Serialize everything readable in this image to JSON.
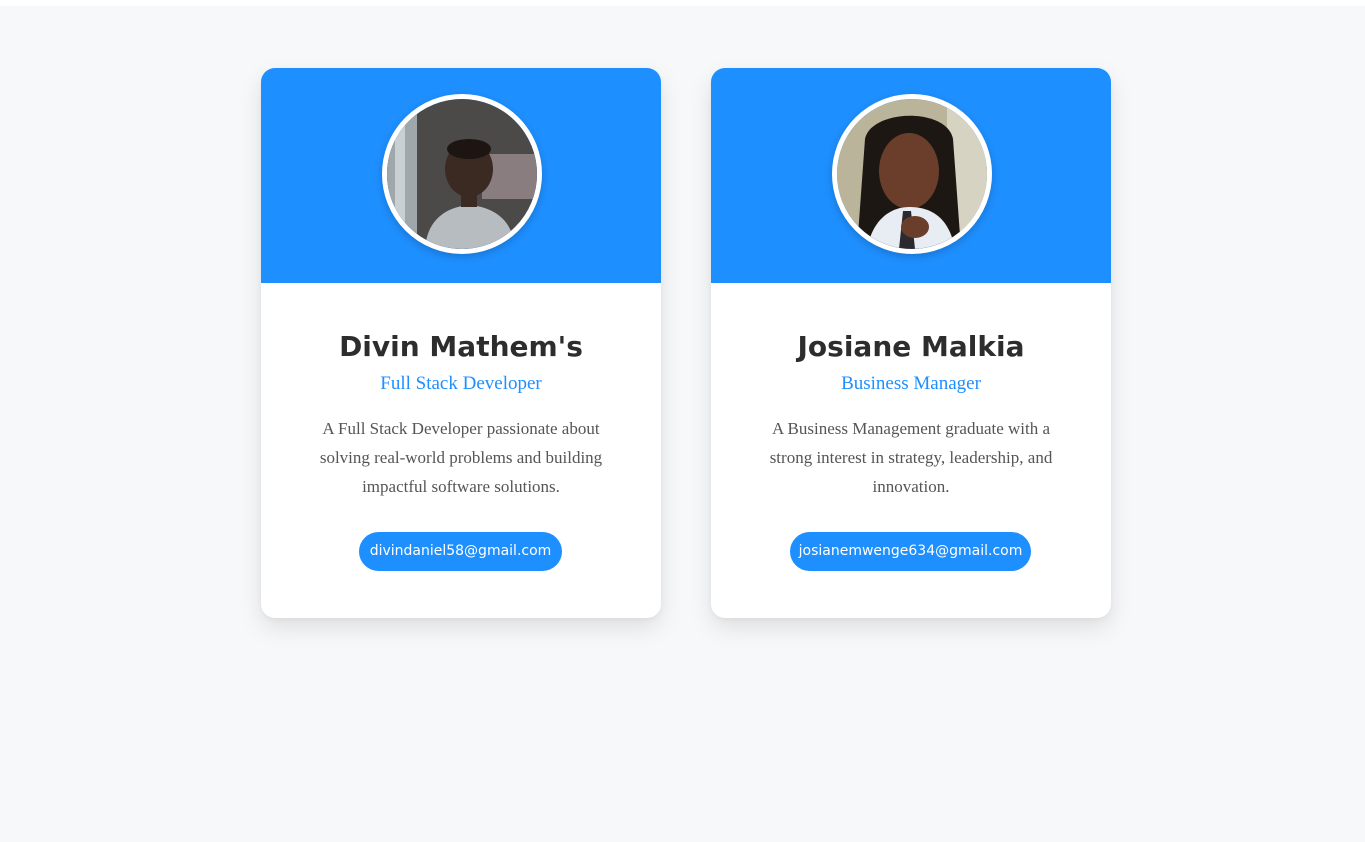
{
  "colors": {
    "accent": "#1e8fff",
    "page_background": "#f7f8fa",
    "card_background": "#ffffff",
    "name_text": "#2d2d2d",
    "bio_text": "#555555"
  },
  "cards": [
    {
      "name": "Divin Mathem's",
      "role": "Full Stack Developer",
      "bio": "A Full Stack Developer passionate about solving real-world problems and building impactful software solutions.",
      "email": "divindaniel58@gmail.com",
      "avatar_icon": "profile-photo-icon"
    },
    {
      "name": "Josiane Malkia",
      "role": "Business Manager",
      "bio": "A Business Management graduate with a strong interest in strategy, leadership, and innovation.",
      "email": "josianemwenge634@gmail.com",
      "avatar_icon": "profile-photo-icon"
    }
  ]
}
